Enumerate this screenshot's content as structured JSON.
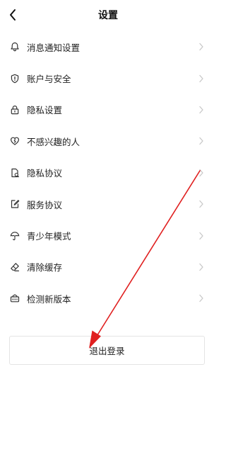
{
  "header": {
    "title": "设置"
  },
  "menu": {
    "items": [
      {
        "label": "消息通知设置",
        "icon": "bell-icon"
      },
      {
        "label": "账户与安全",
        "icon": "shield-icon"
      },
      {
        "label": "隐私设置",
        "icon": "lock-icon"
      },
      {
        "label": "不感兴趣的人",
        "icon": "heart-block-icon"
      },
      {
        "label": "隐私协议",
        "icon": "document-icon"
      },
      {
        "label": "服务协议",
        "icon": "edit-document-icon"
      },
      {
        "label": "青少年模式",
        "icon": "umbrella-icon"
      },
      {
        "label": "清除缓存",
        "icon": "eraser-icon"
      },
      {
        "label": "检测新版本",
        "icon": "update-icon"
      }
    ]
  },
  "logout": {
    "label": "退出登录"
  },
  "colors": {
    "annotation": "#e02020",
    "chevron": "#c8c8c8",
    "border": "#e4e4e4"
  }
}
